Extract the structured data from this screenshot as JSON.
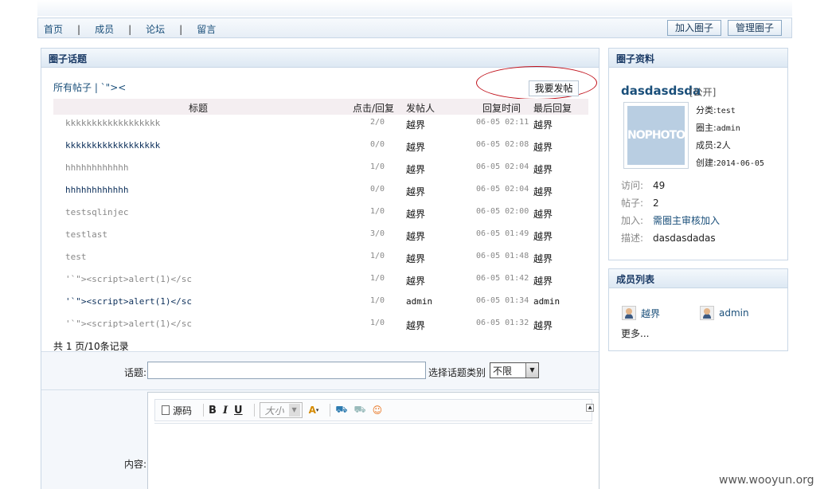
{
  "nav": {
    "links": [
      "首页",
      "成员",
      "论坛",
      "留言"
    ],
    "join_label": "加入圈子",
    "manage_label": "管理圈子"
  },
  "topics": {
    "heading": "圈子话题",
    "filter": "所有帖子 | `\">< ",
    "post_button": "我要发帖",
    "columns": {
      "title": "标题",
      "count": "点击/回复",
      "author": "发帖人",
      "time": "回复时间",
      "last": "最后回复"
    },
    "rows": [
      {
        "title": "kkkkkkkkkkkkkkkkkk",
        "count": "2/0",
        "author": "越界",
        "time": "06-05 02:11",
        "last": "越界",
        "bold": false
      },
      {
        "title": "kkkkkkkkkkkkkkkkkk",
        "count": "0/0",
        "author": "越界",
        "time": "06-05 02:08",
        "last": "越界",
        "bold": true
      },
      {
        "title": "hhhhhhhhhhhh",
        "count": "1/0",
        "author": "越界",
        "time": "06-05 02:04",
        "last": "越界",
        "bold": false
      },
      {
        "title": "hhhhhhhhhhhh",
        "count": "0/0",
        "author": "越界",
        "time": "06-05 02:04",
        "last": "越界",
        "bold": true
      },
      {
        "title": "testsqlinjec",
        "count": "1/0",
        "author": "越界",
        "time": "06-05 02:00",
        "last": "越界",
        "bold": false
      },
      {
        "title": "testlast",
        "count": "3/0",
        "author": "越界",
        "time": "06-05 01:49",
        "last": "越界",
        "bold": false
      },
      {
        "title": "test",
        "count": "1/0",
        "author": "越界",
        "time": "06-05 01:48",
        "last": "越界",
        "bold": false
      },
      {
        "title": "'`\"><script>alert(1)</sc",
        "count": "1/0",
        "author": "越界",
        "time": "06-05 01:42",
        "last": "越界",
        "bold": false
      },
      {
        "title": "'`\"><script>alert(1)</sc",
        "count": "1/0",
        "author": "admin",
        "time": "06-05 01:34",
        "last": "admin",
        "bold": true
      },
      {
        "title": "'`\"><script>alert(1)</sc",
        "count": "1/0",
        "author": "越界",
        "time": "06-05 01:32",
        "last": "越界",
        "bold": false
      }
    ],
    "pager": "共 1 页/10条记录"
  },
  "form": {
    "topic_label": "话题:",
    "category_label": "选择话题类别",
    "category_value": "不限",
    "content_label": "内容:",
    "toolbar": {
      "source": "源码",
      "bold": "B",
      "italic": "I",
      "underline": "U",
      "size": "大小"
    }
  },
  "profile": {
    "heading": "圈子资料",
    "name": "dasdasdsda",
    "visibility": "[公开]",
    "photo_text": "NOPHOTO",
    "category_label": "分类:",
    "category": "test",
    "owner_label": "圈主:",
    "owner": "admin",
    "members_label": "成员:",
    "members": "2人",
    "created_label": "创建:",
    "created": "2014-06-05",
    "visits_label": "访问:",
    "visits": "49",
    "posts_label": "帖子:",
    "posts": "2",
    "join_label": "加入:",
    "join": "需圈主审核加入",
    "desc_label": "描述:",
    "desc": "dasdasdadas"
  },
  "member_list": {
    "heading": "成员列表",
    "members": [
      "越界",
      "admin"
    ],
    "more": "更多..."
  },
  "watermark": "www.wooyun.org"
}
